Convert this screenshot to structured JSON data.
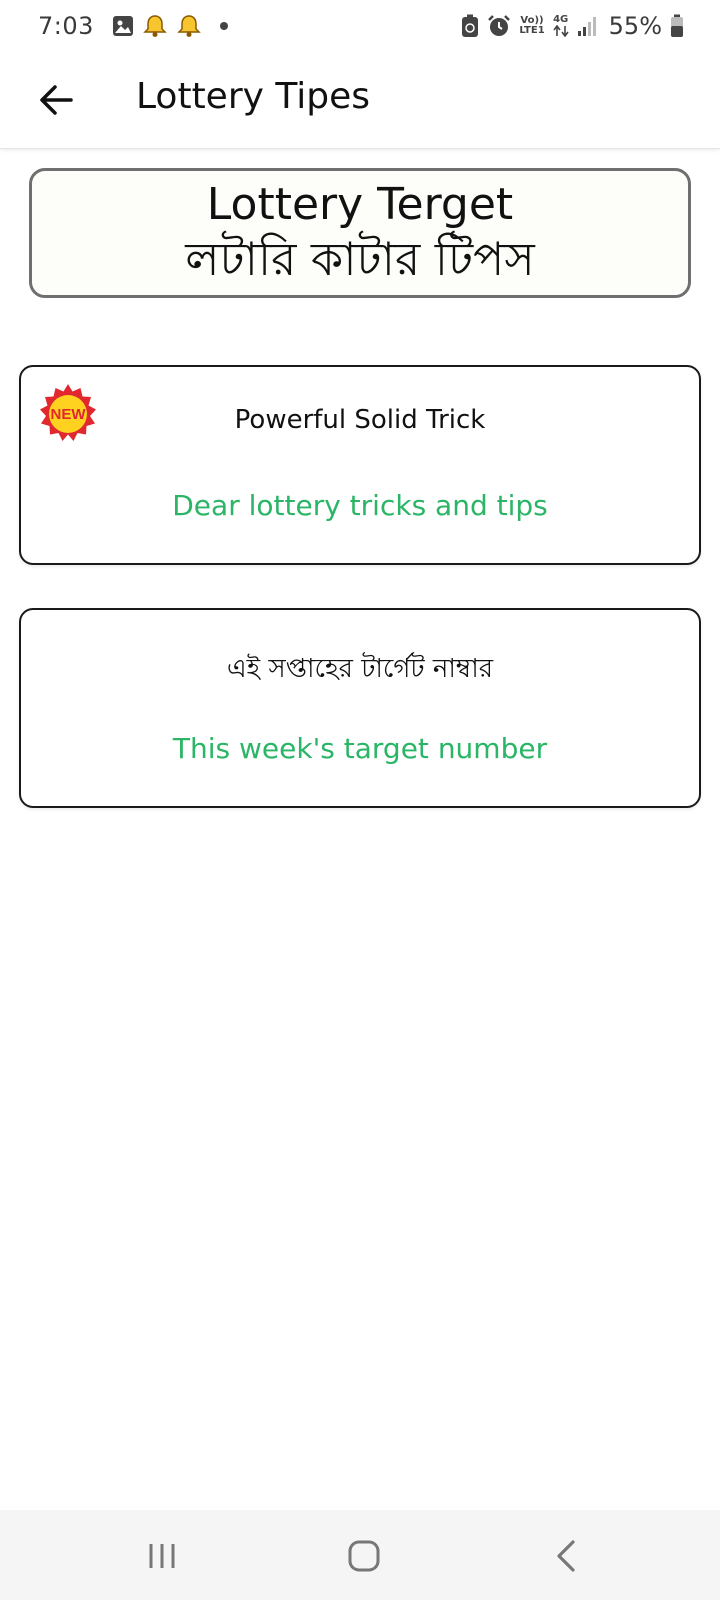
{
  "status_bar": {
    "time": "7:03",
    "left_icons": [
      "image-icon",
      "bell-icon",
      "bell-icon"
    ],
    "volte_line1": "Vo))",
    "volte_line2": "LTE1",
    "network": "4G",
    "battery": "55%"
  },
  "app_bar": {
    "title": "Lottery Tipes"
  },
  "header": {
    "title": "Lottery Terget",
    "subtitle": "লটারি কাটার টিপস"
  },
  "cards": [
    {
      "title": "Powerful Solid Trick",
      "subtitle": "Dear lottery tricks and tips",
      "badge": "NEW"
    },
    {
      "title": "এই সপ্তাহের টার্গেট নাম্বার",
      "subtitle": "This week's target number"
    }
  ],
  "colors": {
    "accent_green": "#2bb566",
    "badge_red": "#e0282e",
    "badge_yellow": "#ffd21f"
  }
}
